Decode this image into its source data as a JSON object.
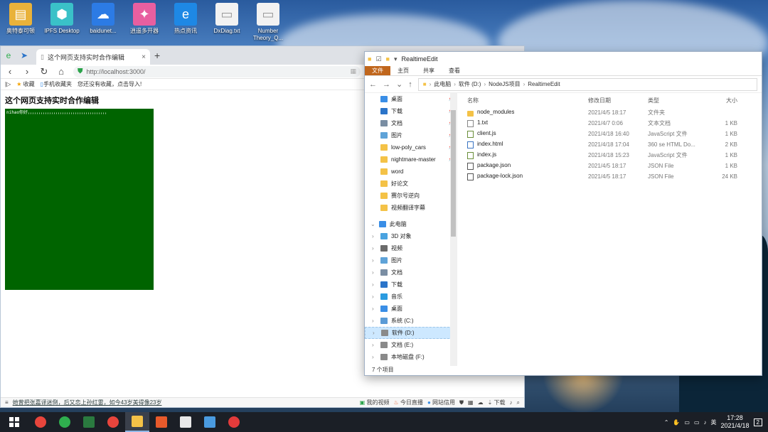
{
  "desktop": {
    "icons": [
      {
        "label": "奥特泰可顿",
        "color": "#e9b23a",
        "glyph": "▤"
      },
      {
        "label": "IPFS Desktop",
        "color": "#3ac1c8",
        "glyph": "⬢"
      },
      {
        "label": "baidunet...",
        "color": "#2c7be5",
        "glyph": "☁"
      },
      {
        "label": "逍遥多开器",
        "color": "#e85fa0",
        "glyph": "✦"
      },
      {
        "label": "热点资讯",
        "color": "#1e88e5",
        "glyph": "e"
      },
      {
        "label": "DxDiag.txt",
        "color": "#f2f2f2",
        "glyph": "▭"
      },
      {
        "label": "Number Theory_Q...",
        "color": "#f2f2f2",
        "glyph": "▭"
      }
    ]
  },
  "browser": {
    "tab_title": "这个网页支持实时合作编辑",
    "tab_close": "×",
    "new_tab": "+",
    "url": "http://localhost:3000/",
    "bookmarks": [
      "收藏",
      "手机收藏夹",
      "您还没有收藏，点击导入!"
    ],
    "page_heading": "这个网页支持实时合作编辑",
    "editor_text": "nihao你好，，，，，，，，，，，，，，，，，，，，，，，，，，，，，，，，，，，，，",
    "status": {
      "news": "她曾把张嘉译迷倒，后又恋上孙红雷，如今43岁美得像23岁",
      "items": [
        "我的视频",
        "今日直播",
        "网站信用",
        "下载"
      ]
    }
  },
  "explorer": {
    "title": "RealtimeEdit",
    "ribbon_tabs": [
      "文件",
      "主页",
      "共享",
      "查看"
    ],
    "breadcrumb": [
      "此电脑",
      "软件 (D:)",
      "NodeJS项目",
      "RealtimeEdit"
    ],
    "quick_access": [
      {
        "label": "桌面",
        "color": "#3a8ee6",
        "pinned": true
      },
      {
        "label": "下载",
        "color": "#2b74c9",
        "pinned": true
      },
      {
        "label": "文档",
        "color": "#7a8ea3",
        "pinned": true
      },
      {
        "label": "图片",
        "color": "#5fa3d8",
        "pinned": true
      },
      {
        "label": "low-poly_cars",
        "color": "#f4c247",
        "pinned": true
      },
      {
        "label": "nightmare-master",
        "color": "#f4c247",
        "pinned": true
      },
      {
        "label": "word",
        "color": "#f4c247",
        "pinned": false
      },
      {
        "label": "好论文",
        "color": "#f4c247",
        "pinned": false
      },
      {
        "label": "赛尔号逆向",
        "color": "#f4c247",
        "pinned": false
      },
      {
        "label": "视频翻译字幕",
        "color": "#f4c247",
        "pinned": false
      }
    ],
    "this_pc_label": "此电脑",
    "this_pc": [
      {
        "label": "3D 对象",
        "color": "#4aa3e0"
      },
      {
        "label": "视频",
        "color": "#6b6b6b"
      },
      {
        "label": "图片",
        "color": "#5fa3d8"
      },
      {
        "label": "文档",
        "color": "#7a8ea3"
      },
      {
        "label": "下载",
        "color": "#2b74c9"
      },
      {
        "label": "音乐",
        "color": "#2b9be0"
      },
      {
        "label": "桌面",
        "color": "#3a8ee6"
      },
      {
        "label": "系统 (C:)",
        "color": "#5a9bd6"
      },
      {
        "label": "软件 (D:)",
        "color": "#8a8a8a",
        "selected": true
      },
      {
        "label": "文档 (E:)",
        "color": "#8a8a8a"
      },
      {
        "label": "本地磁盘 (F:)",
        "color": "#8a8a8a"
      }
    ],
    "columns": {
      "name": "名称",
      "date": "修改日期",
      "type": "类型",
      "size": "大小"
    },
    "files": [
      {
        "name": "node_modules",
        "date": "2021/4/5 18:17",
        "type": "文件夹",
        "size": "",
        "kind": "folder"
      },
      {
        "name": "1.txt",
        "date": "2021/4/7 0:06",
        "type": "文本文档",
        "size": "1 KB",
        "kind": "txt"
      },
      {
        "name": "client.js",
        "date": "2021/4/18 16:40",
        "type": "JavaScript 文件",
        "size": "1 KB",
        "kind": "js"
      },
      {
        "name": "index.html",
        "date": "2021/4/18 17:04",
        "type": "360 se HTML Do...",
        "size": "2 KB",
        "kind": "html"
      },
      {
        "name": "index.js",
        "date": "2021/4/18 15:23",
        "type": "JavaScript 文件",
        "size": "1 KB",
        "kind": "js"
      },
      {
        "name": "package.json",
        "date": "2021/4/5 18:17",
        "type": "JSON File",
        "size": "1 KB",
        "kind": "json"
      },
      {
        "name": "package-lock.json",
        "date": "2021/4/5 18:17",
        "type": "JSON File",
        "size": "24 KB",
        "kind": "json"
      }
    ],
    "status": "7 个项目"
  },
  "taskbar": {
    "apps": [
      {
        "name": "chrome-icon",
        "color": "#e8453c"
      },
      {
        "name": "360-browser-icon",
        "color": "#2fae4e"
      },
      {
        "name": "excel-like-icon",
        "color": "#2a7a3f"
      },
      {
        "name": "chrome-icon-2",
        "color": "#e8453c"
      },
      {
        "name": "file-explorer-icon",
        "color": "#f4c247"
      },
      {
        "name": "media-icon",
        "color": "#e85a2b"
      },
      {
        "name": "typora-icon",
        "color": "#e8e8e8"
      },
      {
        "name": "window-app-icon",
        "color": "#4a9be0"
      },
      {
        "name": "record-icon",
        "color": "#e23b3b"
      }
    ],
    "ime": "英",
    "time": "17:28",
    "date": "2021/4/18",
    "notification_count": "2"
  }
}
